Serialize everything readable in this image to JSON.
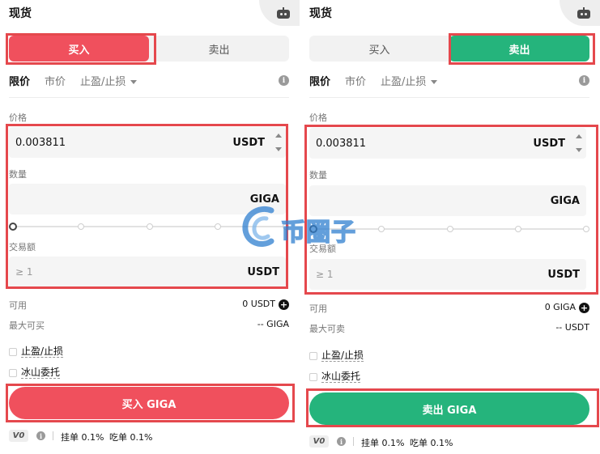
{
  "panels": {
    "buy": {
      "title": "现货",
      "tabs": {
        "buy": "买入",
        "sell": "卖出"
      },
      "order_types": {
        "limit": "限价",
        "market": "市价",
        "tpsl": "止盈/止损"
      },
      "price_label": "价格",
      "price_value": "0.003811",
      "price_unit": "USDT",
      "amount_label": "数量",
      "amount_unit": "GIGA",
      "slider_percent": 0,
      "total_label": "交易额",
      "total_placeholder": "≥ 1",
      "total_unit": "USDT",
      "available_label": "可用",
      "available_value": "0 USDT",
      "max_label": "最大可买",
      "max_value": "-- GIGA",
      "checkbox_tpsl": "止盈/止损",
      "checkbox_iceberg": "冰山委托",
      "submit": "买入 GIGA",
      "vip": "V0",
      "maker_fee": "挂单 0.1%",
      "taker_fee": "吃单 0.1%"
    },
    "sell": {
      "title": "现货",
      "tabs": {
        "buy": "买入",
        "sell": "卖出"
      },
      "order_types": {
        "limit": "限价",
        "market": "市价",
        "tpsl": "止盈/止损"
      },
      "price_label": "价格",
      "price_value": "0.003811",
      "price_unit": "USDT",
      "amount_label": "数量",
      "amount_unit": "GIGA",
      "slider_percent": 0,
      "total_label": "交易额",
      "total_placeholder": "≥ 1",
      "total_unit": "USDT",
      "available_label": "可用",
      "available_value": "0 GIGA",
      "max_label": "最大可卖",
      "max_value": "-- USDT",
      "checkbox_tpsl": "止盈/止损",
      "checkbox_iceberg": "冰山委托",
      "submit": "卖出 GIGA",
      "vip": "V0",
      "maker_fee": "挂单 0.1%",
      "taker_fee": "吃单 0.1%"
    }
  },
  "icons": {
    "header": "robot-icon",
    "info": "info-icon",
    "add": "plus-circle-icon"
  },
  "colors": {
    "buy": "#f0505d",
    "sell": "#25b47c",
    "highlight": "#e5484d"
  },
  "watermark": {
    "text": "币圈子"
  }
}
